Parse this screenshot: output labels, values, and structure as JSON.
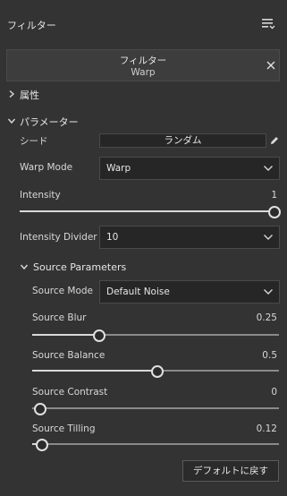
{
  "header": {
    "title": "フィルター"
  },
  "filter": {
    "label": "フィルター",
    "value": "Warp"
  },
  "sections": {
    "attributes": "属性",
    "parameters": "パラメーター",
    "source_parameters": "Source Parameters"
  },
  "seed": {
    "label": "シード",
    "button": "ランダム"
  },
  "warp_mode": {
    "label": "Warp Mode",
    "value": "Warp"
  },
  "intensity": {
    "label": "Intensity",
    "value": "1",
    "fraction": 1.0
  },
  "intensity_divider": {
    "label": "Intensity Divider",
    "value": "10"
  },
  "source_mode": {
    "label": "Source Mode",
    "value": "Default Noise"
  },
  "source_blur": {
    "label": "Source Blur",
    "value": "0.25",
    "fraction": 0.25
  },
  "source_balance": {
    "label": "Source Balance",
    "value": "0.5",
    "fraction": 0.5
  },
  "source_contrast": {
    "label": "Source Contrast",
    "value": "0",
    "fraction": 0.0
  },
  "source_tilling": {
    "label": "Source Tilling",
    "value": "0.12",
    "fraction": 0.02
  },
  "footer": {
    "reset_label": "デフォルトに戻す"
  },
  "icons": [
    "menu-icon",
    "close-icon",
    "chevron-right-icon",
    "chevron-down-icon",
    "pencil-icon"
  ]
}
